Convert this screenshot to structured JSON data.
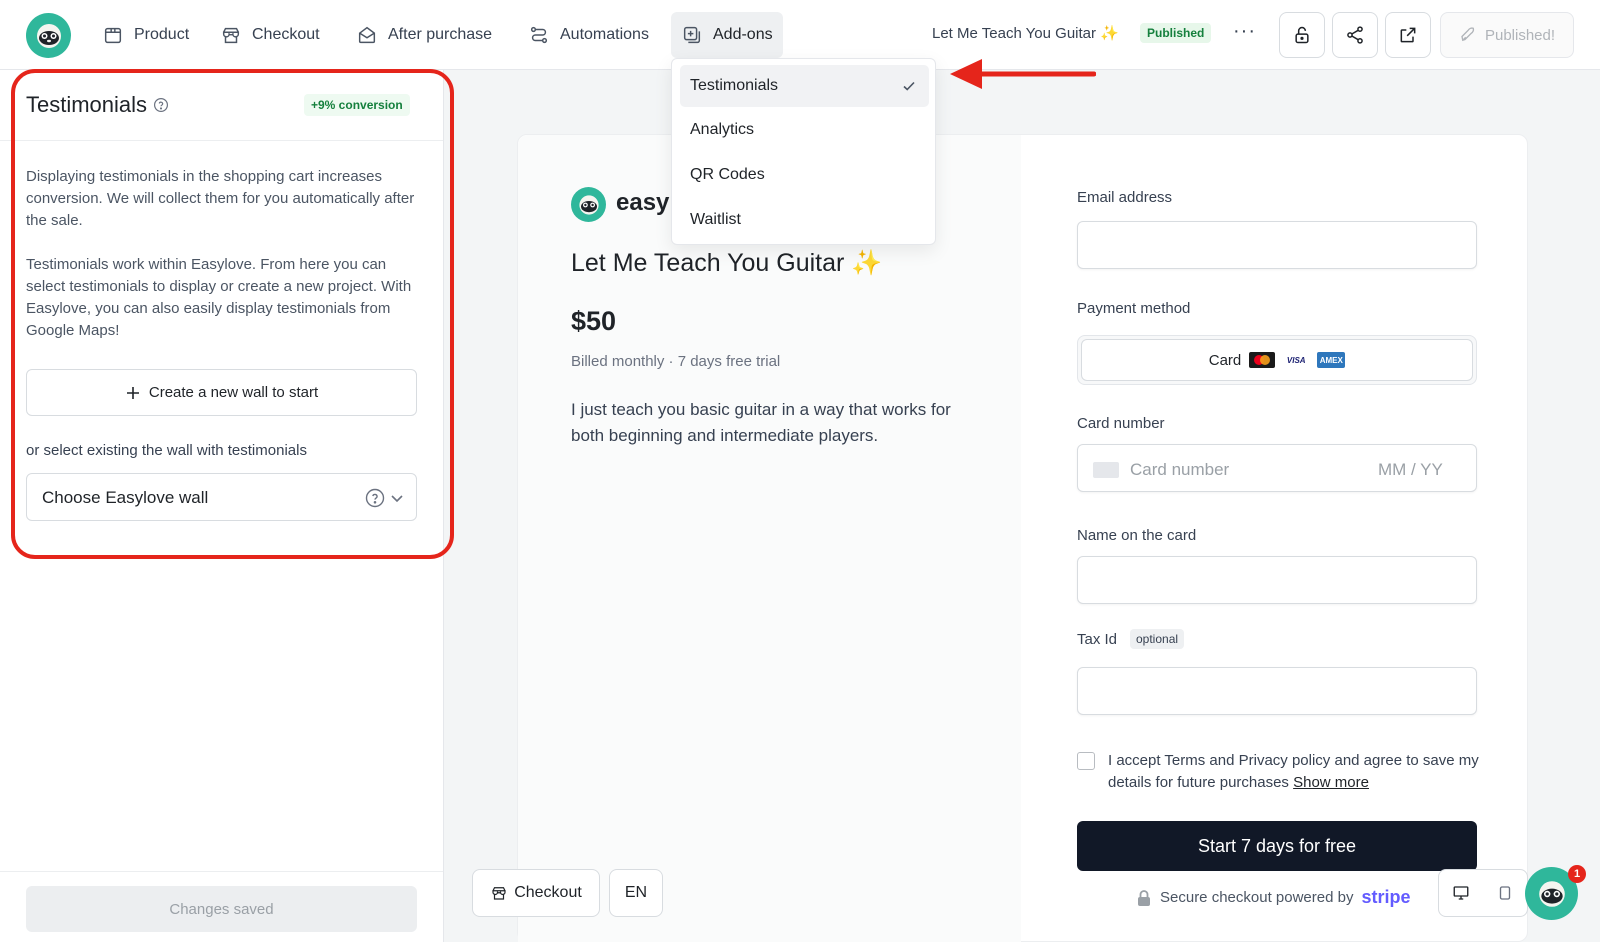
{
  "topbar": {
    "nav": [
      {
        "label": "Product",
        "icon": "box-icon"
      },
      {
        "label": "Checkout",
        "icon": "store-icon"
      },
      {
        "label": "After purchase",
        "icon": "mail-open-icon"
      },
      {
        "label": "Automations",
        "icon": "flow-icon"
      },
      {
        "label": "Add-ons",
        "icon": "plus-square-icon",
        "active": true
      }
    ],
    "project_title": "Let Me Teach You Guitar ✨",
    "status_badge": "Published",
    "more": "···",
    "published_button": "Published!"
  },
  "addons_menu": {
    "items": [
      {
        "label": "Testimonials",
        "selected": true
      },
      {
        "label": "Analytics",
        "selected": false
      },
      {
        "label": "QR Codes",
        "selected": false
      },
      {
        "label": "Waitlist",
        "selected": false
      }
    ]
  },
  "sidebar": {
    "title": "Testimonials",
    "conversion_badge": "+9% conversion",
    "paragraph_1": "Displaying testimonials in the shopping cart increases conversion. We will collect them for you automatically after the sale.",
    "paragraph_2": "Testimonials work within Easylove. From here you can select testimonials to display or create a new project. With Easylove, you can also easily display testimonials from Google Maps!",
    "create_button": "Create a new wall to start",
    "select_label": "or select existing the wall with testimonials",
    "wall_select_value": "Choose Easylove wall",
    "footer_button": "Changes saved"
  },
  "checkout_preview": {
    "brand_name": "easy",
    "product_title": "Let Me Teach You Guitar ✨",
    "price": "$50",
    "billing": "Billed monthly · 7 days free trial",
    "description": "I just teach you basic guitar in a way that works for both beginning and intermediate players.",
    "email_label": "Email address",
    "payment_label": "Payment method",
    "payment_option": "Card",
    "card_brands": [
      "mastercard",
      "visa",
      "amex"
    ],
    "card_number_label": "Card number",
    "card_number_placeholder": "Card number",
    "expiry_placeholder": "MM / YY",
    "name_label": "Name on the card",
    "tax_label": "Tax Id",
    "tax_optional": "optional",
    "terms_text": "I accept Terms and Privacy policy and agree to save my details for future purchases",
    "terms_link": "Show more",
    "cta": "Start 7 days for free",
    "secure_text": "Secure checkout powered by",
    "stripe": "stripe"
  },
  "canvas_controls": {
    "checkout_button": "Checkout",
    "language": "EN"
  },
  "chat": {
    "unread": "1"
  },
  "colors": {
    "brand": "#2fb79b",
    "highlight": "#e5251b",
    "cta_bg": "#111827",
    "stripe": "#635bff",
    "published": "#15803d"
  }
}
